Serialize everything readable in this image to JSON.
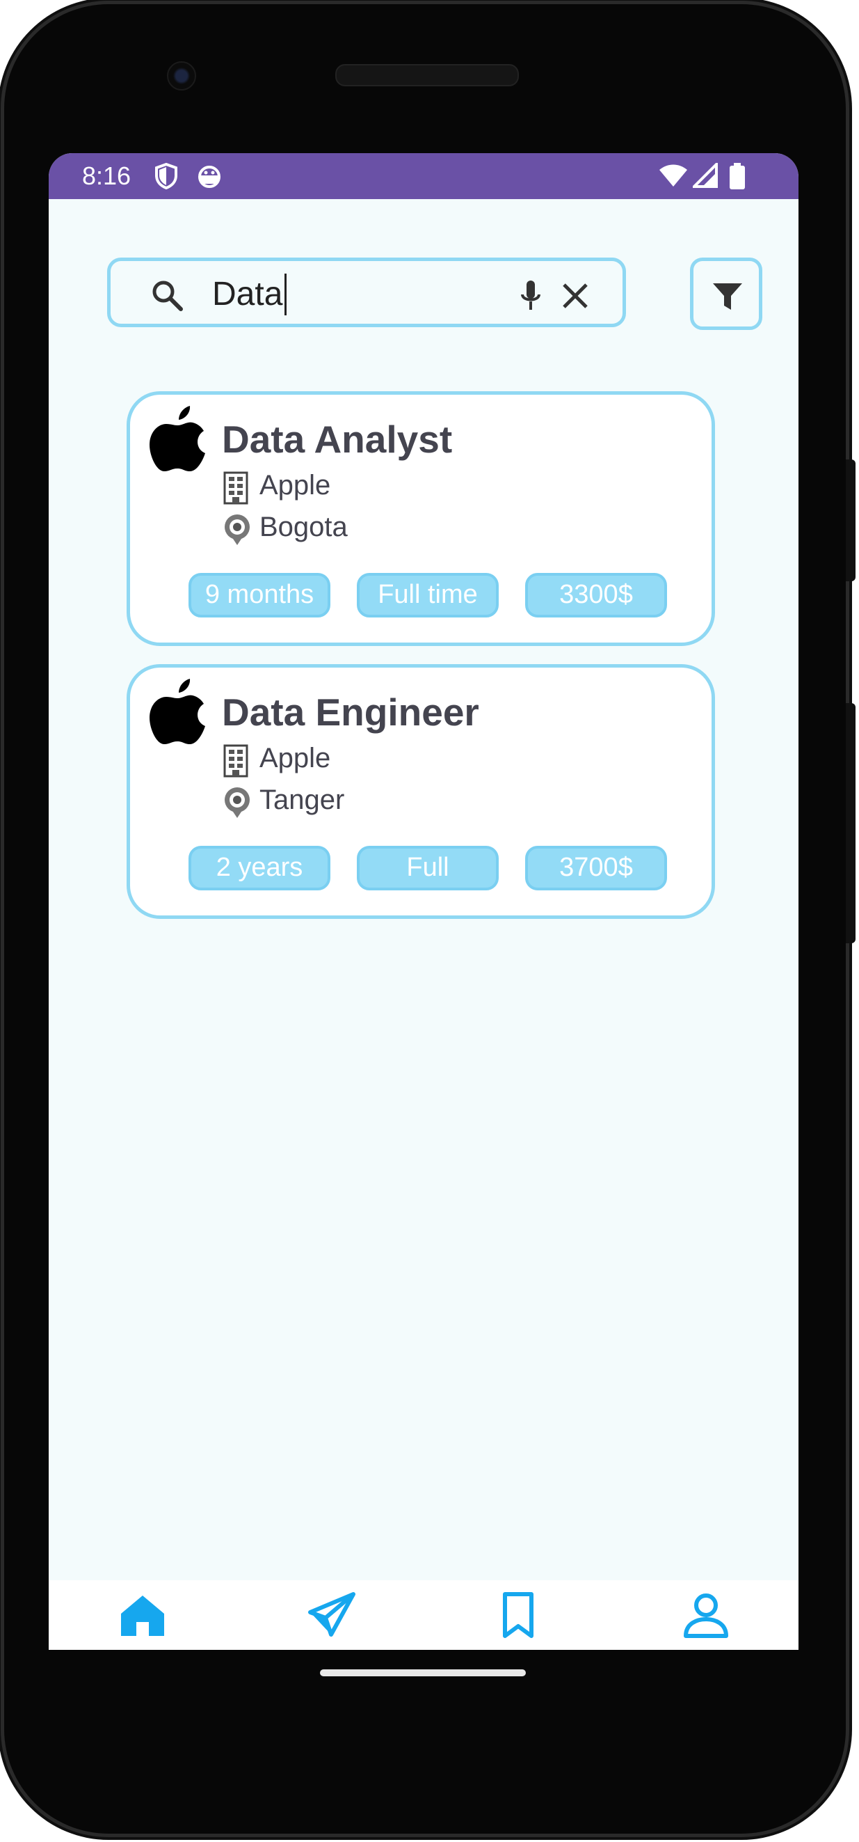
{
  "status_bar": {
    "time": "8:16"
  },
  "search": {
    "value": "Data"
  },
  "jobs": [
    {
      "title": "Data Analyst",
      "company": "Apple",
      "location": "Bogota",
      "duration": "9 months",
      "type": "Full time",
      "salary": "3300$"
    },
    {
      "title": "Data Engineer",
      "company": "Apple",
      "location": "Tanger",
      "duration": "2 years",
      "type": "Full",
      "salary": "3700$"
    }
  ],
  "bottom_nav": {
    "items": [
      {
        "icon": "home-icon",
        "active": true
      },
      {
        "icon": "send-icon",
        "active": false
      },
      {
        "icon": "bookmark-icon",
        "active": false
      },
      {
        "icon": "profile-icon",
        "active": false
      }
    ]
  },
  "colors": {
    "status_bar": "#6a51a6",
    "accent": "#8fd8f3",
    "chip": "#93dbf6",
    "nav_icon": "#16a7ee",
    "text": "#44444f"
  }
}
